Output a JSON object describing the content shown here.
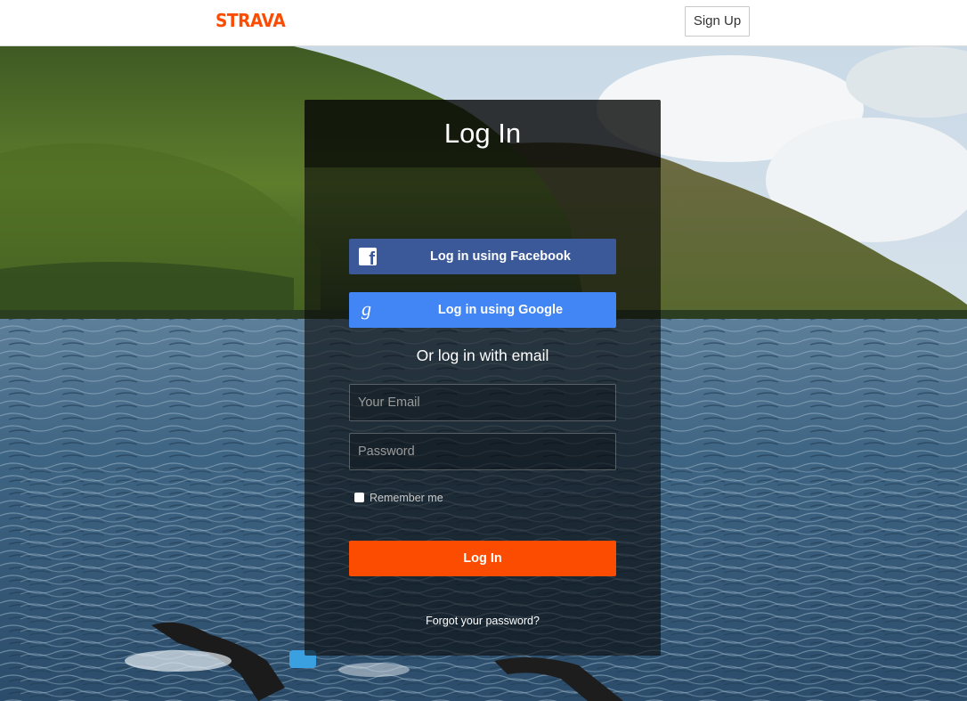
{
  "header": {
    "brand": "STRAVA",
    "signup_label": "Sign Up"
  },
  "login": {
    "title": "Log In",
    "facebook_label": "Log in using Facebook",
    "facebook_icon": "facebook-icon",
    "google_label": "Log in using Google",
    "google_icon": "google-icon",
    "or_email": "Or log in with email",
    "email_placeholder": "Your Email",
    "password_placeholder": "Password",
    "remember_label": "Remember me",
    "submit_label": "Log In",
    "forgot_label": "Forgot your password?"
  },
  "colors": {
    "brand_orange": "#fc4c02",
    "facebook_blue": "#3b5998",
    "google_blue": "#4285f4"
  }
}
